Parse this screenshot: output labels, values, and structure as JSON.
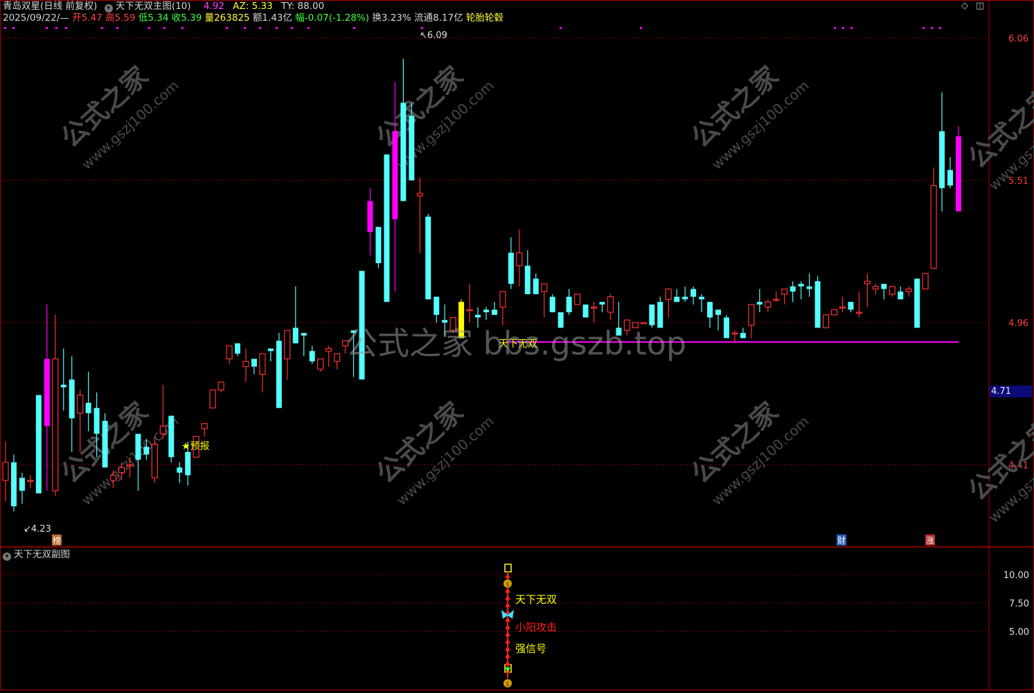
{
  "header": {
    "stock_name": "青岛双星(日线 前复权)",
    "indicator_name": "天下无双主图(10)",
    "ind_val1": "4.92",
    "ind_az": "AZ: 5.33",
    "ind_ty": "TY: 88.00",
    "date": "2025/09/22/—",
    "open": "开5.47",
    "high": "高5.59",
    "low": "低5.34",
    "close": "收5.39",
    "volume": "量263825",
    "amount": "额1.43亿",
    "change": "幅-0.07(-1.28%)",
    "turnover": "换3.23%",
    "float": "流通8.17亿",
    "concept": "轮胎轮毂"
  },
  "price_tag": "4.71",
  "sub_panel_title": "天下无双副图",
  "watermarks": {
    "center": "公式之家 bbs.gszb.top",
    "small_cn": "公式之家",
    "small_url": "www.gszj100.com"
  },
  "colors": {
    "up": "#ff3232",
    "down": "#54ffff",
    "signal": "#ff00ff",
    "grid": "#8b0000",
    "yellow": "#ffff00"
  },
  "chart_data": {
    "type": "candlestick",
    "y_axis": {
      "range": [
        4.2,
        6.15
      ],
      "ticks": [
        "6.06",
        "5.51",
        "4.96",
        "4.41"
      ]
    },
    "candles": [
      [
        4.35,
        4.5,
        4.27,
        4.42
      ],
      [
        4.42,
        4.45,
        4.23,
        4.25
      ],
      [
        4.36,
        4.38,
        4.26,
        4.31
      ],
      [
        4.35,
        4.37,
        4.32,
        4.35
      ],
      [
        4.68,
        4.68,
        4.3,
        4.3
      ],
      [
        4.82,
        5.03,
        4.31,
        4.56
      ],
      [
        4.31,
        4.99,
        4.29,
        4.82
      ],
      [
        4.72,
        4.86,
        4.62,
        4.71
      ],
      [
        4.74,
        4.83,
        4.46,
        4.59
      ],
      [
        4.61,
        4.7,
        4.46,
        4.68
      ],
      [
        4.65,
        4.77,
        4.54,
        4.61
      ],
      [
        4.63,
        4.69,
        4.44,
        4.53
      ],
      [
        4.58,
        4.61,
        4.41,
        4.4
      ],
      [
        4.35,
        4.39,
        4.32,
        4.37
      ],
      [
        4.38,
        4.42,
        4.35,
        4.4
      ],
      [
        4.41,
        4.44,
        4.36,
        4.41
      ],
      [
        4.53,
        4.53,
        4.31,
        4.43
      ],
      [
        4.48,
        4.51,
        4.43,
        4.45
      ],
      [
        4.36,
        4.52,
        4.34,
        4.49
      ],
      [
        4.53,
        4.72,
        4.51,
        4.56
      ],
      [
        4.6,
        4.58,
        4.42,
        4.44
      ],
      [
        4.4,
        4.42,
        4.34,
        4.38
      ],
      [
        4.46,
        4.5,
        4.33,
        4.37
      ],
      [
        4.44,
        4.45,
        4.46,
        4.52
      ],
      [
        4.55,
        4.55,
        4.52,
        4.57
      ],
      [
        4.63,
        4.64,
        4.67,
        4.7
      ],
      [
        4.7,
        4.69,
        4.7,
        4.73
      ],
      [
        4.82,
        4.83,
        4.8,
        4.87
      ],
      [
        4.88,
        4.88,
        4.83,
        4.84
      ],
      [
        4.79,
        4.86,
        4.73,
        4.81
      ],
      [
        4.82,
        4.81,
        4.76,
        4.79
      ],
      [
        4.76,
        4.75,
        4.69,
        4.84
      ],
      [
        4.86,
        4.81,
        4.85,
        4.85
      ],
      [
        4.89,
        4.92,
        4.79,
        4.63
      ],
      [
        4.82,
        4.84,
        4.74,
        4.93
      ],
      [
        4.94,
        5.1,
        4.9,
        4.88
      ],
      [
        4.92,
        4.88,
        4.83,
        4.91
      ],
      [
        4.85,
        4.87,
        4.8,
        4.81
      ],
      [
        4.78,
        4.77,
        4.77,
        4.82
      ],
      [
        4.85,
        4.87,
        4.79,
        4.86
      ],
      [
        4.81,
        4.78,
        4.79,
        4.84
      ],
      [
        4.87,
        4.88,
        4.84,
        4.89
      ],
      [
        4.93,
        4.75,
        4.75,
        4.92
      ],
      [
        5.16,
        5.16,
        4.74,
        4.74
      ],
      [
        5.43,
        5.48,
        5.22,
        5.31
      ],
      [
        5.33,
        5.33,
        5.17,
        5.19
      ],
      [
        5.61,
        5.61,
        5.04,
        5.04
      ],
      [
        5.7,
        5.89,
        5.08,
        5.36
      ],
      [
        5.81,
        5.98,
        5.55,
        5.43
      ],
      [
        5.76,
        5.81,
        5.51,
        5.51
      ],
      [
        5.45,
        5.52,
        5.23,
        5.46
      ],
      [
        5.37,
        5.38,
        5.08,
        5.05
      ],
      [
        5.06,
        5.06,
        4.96,
        4.99
      ],
      [
        4.97,
        5.03,
        4.91,
        4.96
      ],
      [
        4.93,
        4.92,
        4.93,
        4.98
      ],
      [
        5.04,
        5.05,
        4.93,
        4.9
      ],
      [
        5.01,
        5.11,
        4.96,
        5.01
      ],
      [
        4.99,
        5.02,
        4.94,
        4.98
      ],
      [
        5.01,
        5.02,
        4.97,
        5.0
      ],
      [
        5.01,
        5.04,
        5.0,
        4.99
      ],
      [
        5.02,
        5.08,
        4.95,
        5.08
      ],
      [
        5.23,
        5.29,
        5.09,
        5.11
      ],
      [
        5.18,
        5.32,
        5.1,
        5.23
      ],
      [
        5.18,
        5.24,
        5.08,
        5.07
      ],
      [
        5.13,
        5.15,
        5.08,
        5.07
      ],
      [
        5.08,
        5.03,
        4.98,
        5.11
      ],
      [
        5.06,
        5.07,
        5.01,
        5.0
      ],
      [
        5.0,
        5.0,
        4.95,
        4.94
      ],
      [
        5.06,
        5.09,
        4.99,
        5.0
      ],
      [
        5.03,
        5.05,
        5.03,
        5.07
      ],
      [
        5.03,
        5.03,
        5.0,
        4.98
      ],
      [
        5.02,
        5.04,
        4.96,
        5.02
      ],
      [
        5.04,
        5.03,
        5.0,
        5.03
      ],
      [
        5.0,
        5.07,
        4.97,
        5.06
      ],
      [
        4.94,
        5.04,
        4.93,
        4.91
      ],
      [
        4.93,
        4.94,
        4.91,
        4.97
      ],
      [
        4.94,
        4.96,
        4.94,
        4.96
      ],
      [
        4.96,
        4.96,
        4.96,
        4.96
      ],
      [
        5.03,
        5.03,
        4.94,
        4.95
      ],
      [
        5.04,
        5.06,
        5.02,
        4.94
      ],
      [
        5.05,
        5.05,
        4.98,
        5.09
      ],
      [
        5.06,
        5.09,
        5.06,
        5.04
      ],
      [
        5.06,
        5.1,
        5.04,
        5.05
      ],
      [
        5.09,
        5.1,
        5.03,
        5.06
      ],
      [
        5.06,
        5.07,
        5.0,
        5.05
      ],
      [
        5.04,
        5.04,
        4.94,
        4.98
      ],
      [
        5.01,
        5.01,
        4.93,
        4.99
      ],
      [
        4.98,
        4.99,
        4.91,
        4.9
      ],
      [
        4.92,
        4.93,
        4.88,
        4.92
      ],
      [
        4.92,
        4.94,
        4.91,
        4.9
      ],
      [
        4.95,
        4.96,
        4.9,
        5.03
      ],
      [
        5.04,
        5.09,
        5.0,
        5.03
      ],
      [
        5.02,
        5.05,
        5.0,
        5.04
      ],
      [
        5.05,
        5.08,
        5.04,
        5.05
      ],
      [
        5.07,
        5.09,
        5.03,
        5.09
      ],
      [
        5.1,
        5.12,
        5.04,
        5.08
      ],
      [
        5.11,
        5.12,
        5.05,
        5.1
      ],
      [
        5.1,
        5.15,
        5.06,
        5.09
      ],
      [
        5.12,
        5.14,
        4.97,
        4.94
      ],
      [
        4.94,
        4.96,
        4.94,
        4.99
      ],
      [
        4.99,
        5.0,
        4.99,
        5.01
      ],
      [
        5.02,
        5.06,
        5.0,
        5.02
      ],
      [
        5.04,
        5.04,
        5.0,
        5.01
      ],
      [
        5.0,
        5.08,
        4.98,
        5.0
      ],
      [
        5.11,
        5.15,
        5.02,
        5.12
      ],
      [
        5.09,
        5.11,
        5.07,
        5.1
      ],
      [
        5.11,
        5.11,
        5.05,
        5.09
      ],
      [
        5.07,
        5.09,
        5.06,
        5.1
      ],
      [
        5.08,
        5.1,
        5.05,
        5.05
      ],
      [
        5.08,
        5.1,
        5.06,
        5.09
      ],
      [
        5.13,
        5.13,
        4.97,
        4.94
      ],
      [
        5.09,
        5.09,
        5.09,
        5.15
      ],
      [
        5.17,
        5.56,
        5.17,
        5.49
      ],
      [
        5.7,
        5.85,
        5.39,
        5.48
      ],
      [
        5.55,
        5.6,
        5.48,
        5.49
      ],
      [
        5.68,
        5.72,
        5.39,
        5.39
      ]
    ],
    "annotations": {
      "high_label": "6.09",
      "low_label": "4.23",
      "label_yubao": "★预报",
      "label_main": "天下无双"
    },
    "bottom_markers": [
      "榜",
      "财",
      "涨"
    ],
    "sub_axis": {
      "ticks": [
        "10.00",
        "7.50",
        "5.00"
      ]
    },
    "sub_labels": [
      "天下无双",
      "小阳攻击",
      "强信号"
    ]
  }
}
